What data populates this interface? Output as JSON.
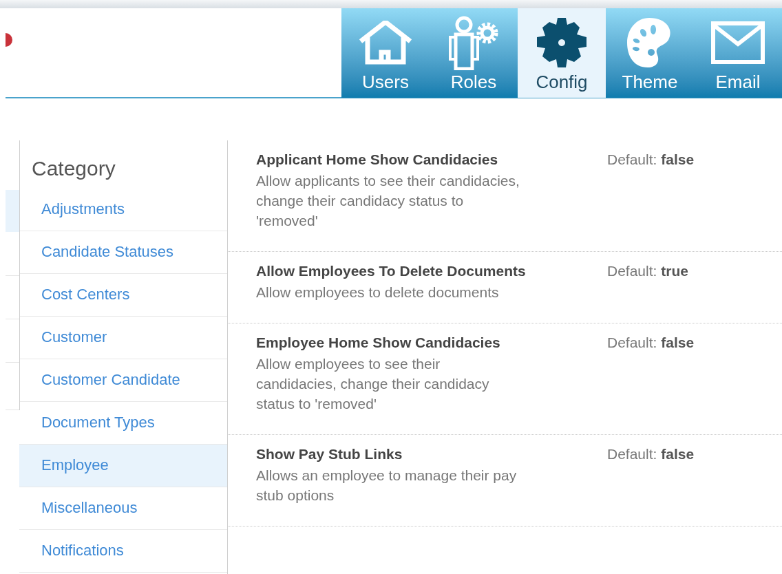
{
  "nav_tabs": [
    {
      "kind": "house",
      "label": "Users",
      "selected": false
    },
    {
      "kind": "person-gear",
      "label": "Roles",
      "selected": false
    },
    {
      "kind": "gear",
      "label": "Config",
      "selected": true
    },
    {
      "kind": "palette",
      "label": "Theme",
      "selected": false
    },
    {
      "kind": "envelope",
      "label": "Email",
      "selected": false
    }
  ],
  "sidebar": {
    "title": "Category",
    "items": [
      {
        "label": "Adjustments",
        "selected": false
      },
      {
        "label": "Candidate Statuses",
        "selected": false
      },
      {
        "label": "Cost Centers",
        "selected": false
      },
      {
        "label": "Customer",
        "selected": false
      },
      {
        "label": "Customer Candidate",
        "selected": false
      },
      {
        "label": "Document Types",
        "selected": false
      },
      {
        "label": "Employee",
        "selected": true
      },
      {
        "label": "Miscellaneous",
        "selected": false
      },
      {
        "label": "Notifications",
        "selected": false
      }
    ]
  },
  "settings": [
    {
      "name": "Applicant Home Show Candidacies",
      "description": "Allow applicants to see their candidacies, change their candidacy status to 'removed'",
      "default": "Default: **false**"
    },
    {
      "name": "Allow Employees To Delete Documents",
      "description": "Allow employees to delete documents",
      "default": "Default: **true**"
    },
    {
      "name": "Employee Home Show Candidacies",
      "description": "Allow employees to see their candidacies, change their candidacy status to 'removed'",
      "default": "Default: **false**"
    },
    {
      "name": "Show Pay Stub Links",
      "description": "Allows an employee to manage their pay stub options",
      "default": "Default: **false**"
    }
  ]
}
